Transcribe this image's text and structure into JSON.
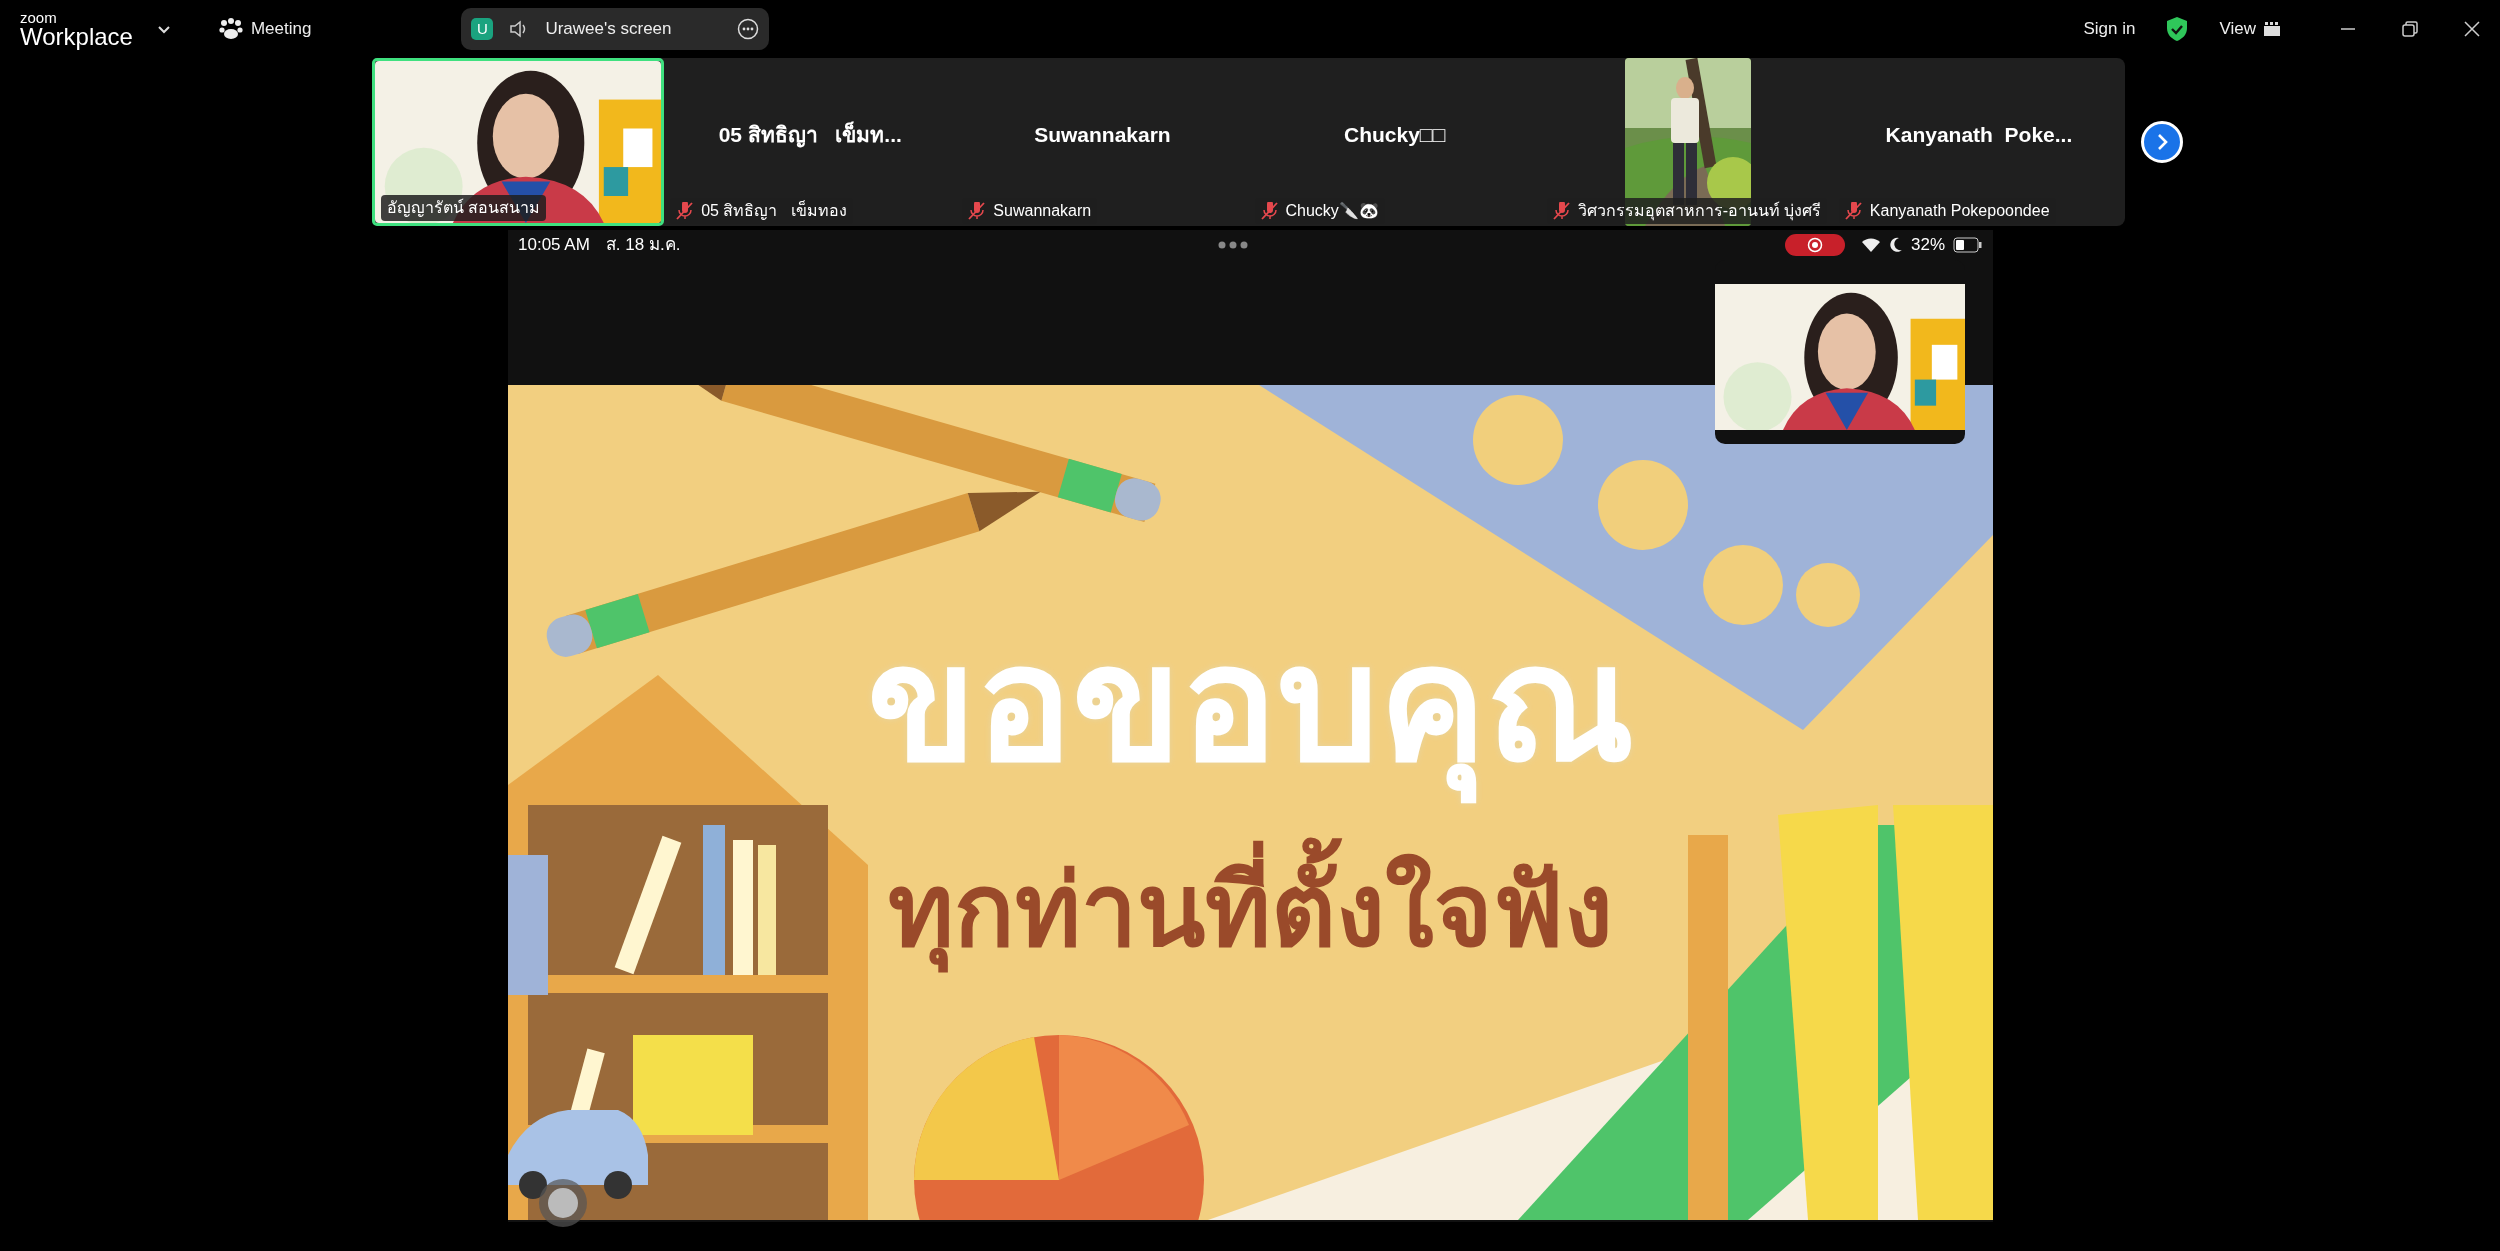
{
  "app": {
    "logo_top": "zoom",
    "logo_bottom": "Workplace",
    "meeting_label": "Meeting",
    "share_pill": {
      "avatar": "U",
      "label": "Urawee's screen"
    },
    "sign_in": "Sign in",
    "view": "View"
  },
  "participants": [
    {
      "kind": "video",
      "label": "อัญญารัตน์ สอนสนาม",
      "muted": false,
      "active_speaker": true
    },
    {
      "kind": "name",
      "name": "05 สิทธิญา   เข็มท...",
      "label": "05 สิทธิญา   เข็มทอง",
      "muted": true,
      "active_speaker": false
    },
    {
      "kind": "name",
      "name": "Suwannakarn",
      "label": "Suwannakarn",
      "muted": true,
      "active_speaker": false
    },
    {
      "kind": "name",
      "name": "Chucky□□",
      "label": "Chucky🔪🐼",
      "muted": true,
      "active_speaker": false
    },
    {
      "kind": "video",
      "label": "วิศวกรรมอุตสาหการ-อานนท์ บุ่งศรี",
      "muted": true,
      "active_speaker": false
    },
    {
      "kind": "name",
      "name": "Kanyanath  Poke...",
      "label": "Kanyanath Pokepoondee",
      "muted": true,
      "active_speaker": false
    }
  ],
  "shared_screen": {
    "status_bar": {
      "time": "10:05 AM",
      "date": "ส. 18 ม.ค.",
      "battery": "32%"
    },
    "slide": {
      "title": "ขอขอบคุณ",
      "subtitle": "ทุกท่านที่ตั้งใจฟัง"
    }
  }
}
